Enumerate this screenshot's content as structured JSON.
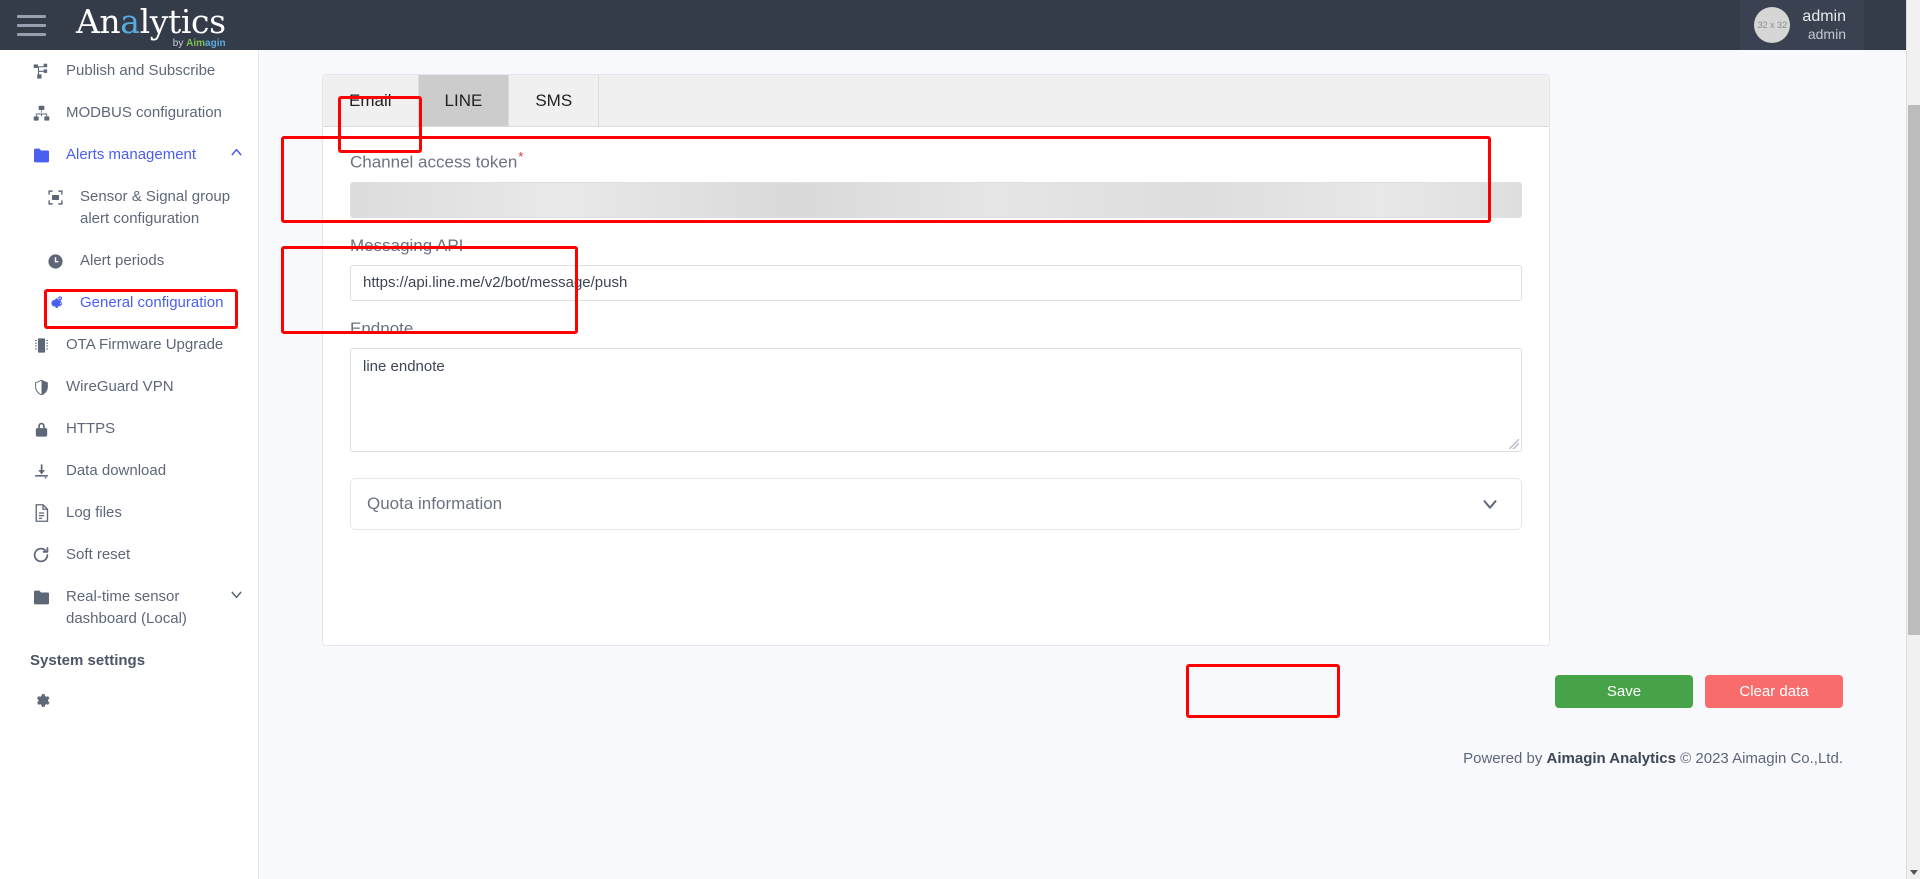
{
  "header": {
    "menu_icon": "hamburger-icon",
    "logo_prefix": "An",
    "logo_accent": "a",
    "logo_suffix": "lytics",
    "logo_sub_by": "by ",
    "logo_sub_brand_a": "Aim",
    "logo_sub_brand_b": "agin",
    "avatar_placeholder": "32 x 32",
    "user_primary": "admin",
    "user_secondary": "admin"
  },
  "sidebar": {
    "items": [
      {
        "label": "Publish and Subscribe",
        "icon": "share-nodes-icon",
        "level": "root",
        "state": "default",
        "chevron": ""
      },
      {
        "label": "MODBUS configuration",
        "icon": "network-icon",
        "level": "root",
        "state": "default",
        "chevron": ""
      },
      {
        "label": "Alerts management",
        "icon": "folder-icon",
        "level": "root",
        "state": "expanded",
        "chevron": "chevron-up-icon"
      },
      {
        "label": "Sensor & Signal group alert configuration",
        "icon": "sensor-frame-icon",
        "level": "sub",
        "state": "default",
        "chevron": ""
      },
      {
        "label": "Alert periods",
        "icon": "clock-icon",
        "level": "sub",
        "state": "default",
        "chevron": ""
      },
      {
        "label": "General configuration",
        "icon": "gears-icon",
        "level": "sub",
        "state": "active",
        "chevron": ""
      },
      {
        "label": "OTA Firmware Upgrade",
        "icon": "chip-icon",
        "level": "root",
        "state": "default",
        "chevron": ""
      },
      {
        "label": "WireGuard VPN",
        "icon": "shield-icon",
        "level": "root",
        "state": "default",
        "chevron": ""
      },
      {
        "label": "HTTPS",
        "icon": "lock-icon",
        "level": "root",
        "state": "default",
        "chevron": ""
      },
      {
        "label": "Data download",
        "icon": "download-icon",
        "level": "root",
        "state": "default",
        "chevron": ""
      },
      {
        "label": "Log files",
        "icon": "file-lines-icon",
        "level": "root",
        "state": "default",
        "chevron": ""
      },
      {
        "label": "Soft reset",
        "icon": "refresh-icon",
        "level": "root",
        "state": "default",
        "chevron": ""
      },
      {
        "label": "Real-time sensor dashboard (Local)",
        "icon": "folder-icon",
        "level": "root",
        "state": "collapsed",
        "chevron": "chevron-down-icon"
      }
    ],
    "section_heading": "System settings"
  },
  "main": {
    "tabs": [
      {
        "label": "Email",
        "active": false
      },
      {
        "label": "LINE",
        "active": true
      },
      {
        "label": "SMS",
        "active": false
      }
    ],
    "fields": {
      "channel_access_token": {
        "label": "Channel access token",
        "required_marker": "*",
        "value": "",
        "masked": true
      },
      "messaging_api": {
        "label": "Messaging API",
        "value": "https://api.line.me/v2/bot/message/push"
      },
      "endnote": {
        "label": "Endnote",
        "value": "line endnote"
      }
    },
    "accordion": {
      "label": "Quota information",
      "chevron": "chevron-down-icon",
      "expanded": false
    },
    "buttons": {
      "save": "Save",
      "clear": "Clear data"
    },
    "footer": {
      "prefix": "Powered by ",
      "brand": "Aimagin Analytics",
      "suffix": " © 2023 Aimagin Co.,Ltd."
    }
  },
  "highlights": {
    "color": "#ff0000",
    "targets": [
      "tab-line",
      "channel-access-token-field",
      "messaging-api-field",
      "sidebar-item-general-configuration",
      "save-button"
    ]
  }
}
